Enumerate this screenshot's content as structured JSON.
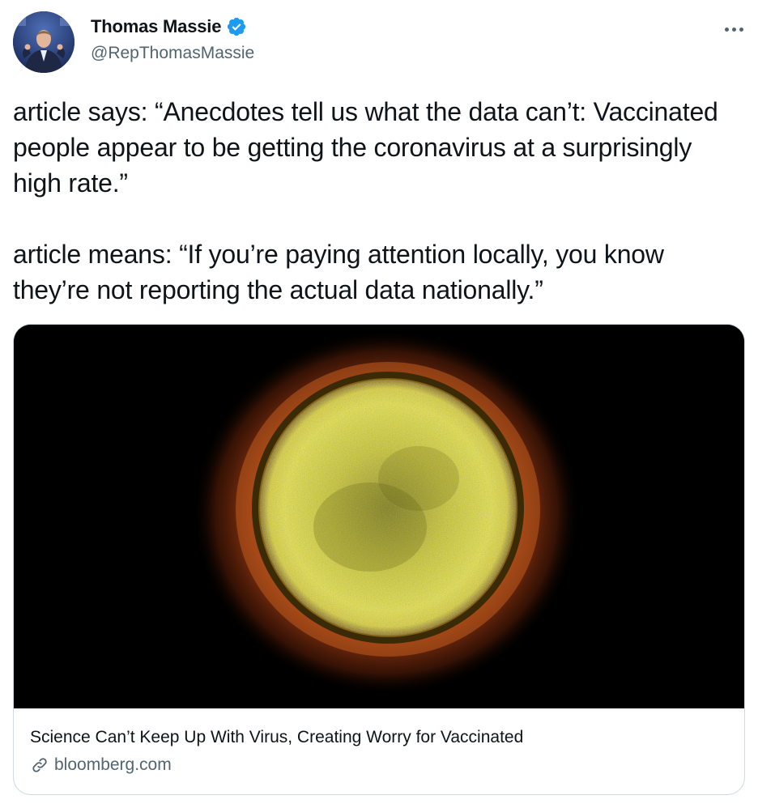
{
  "author": {
    "name": "Thomas Massie",
    "handle": "@RepThomasMassie",
    "verified": true,
    "verified_icon": "verified-badge-icon",
    "verified_color": "#1d9bf0"
  },
  "tweet": {
    "text": "article says: “Anecdotes tell us what the data can’t: Vaccinated people appear to be getting the coronavirus at a surprisingly high rate.”\n\narticle means: “If you’re paying attention locally, you know they’re not reporting the actual data nationally.”"
  },
  "card": {
    "image_icon": "coronavirus-micrograph-image",
    "title": "Science Can’t Keep Up With Virus, Creating Worry for Vaccinated",
    "domain": "bloomberg.com",
    "link_icon": "link-icon"
  },
  "colors": {
    "text_primary": "#0f1419",
    "text_secondary": "#536471",
    "border": "#cfd9de",
    "accent": "#1d9bf0"
  }
}
